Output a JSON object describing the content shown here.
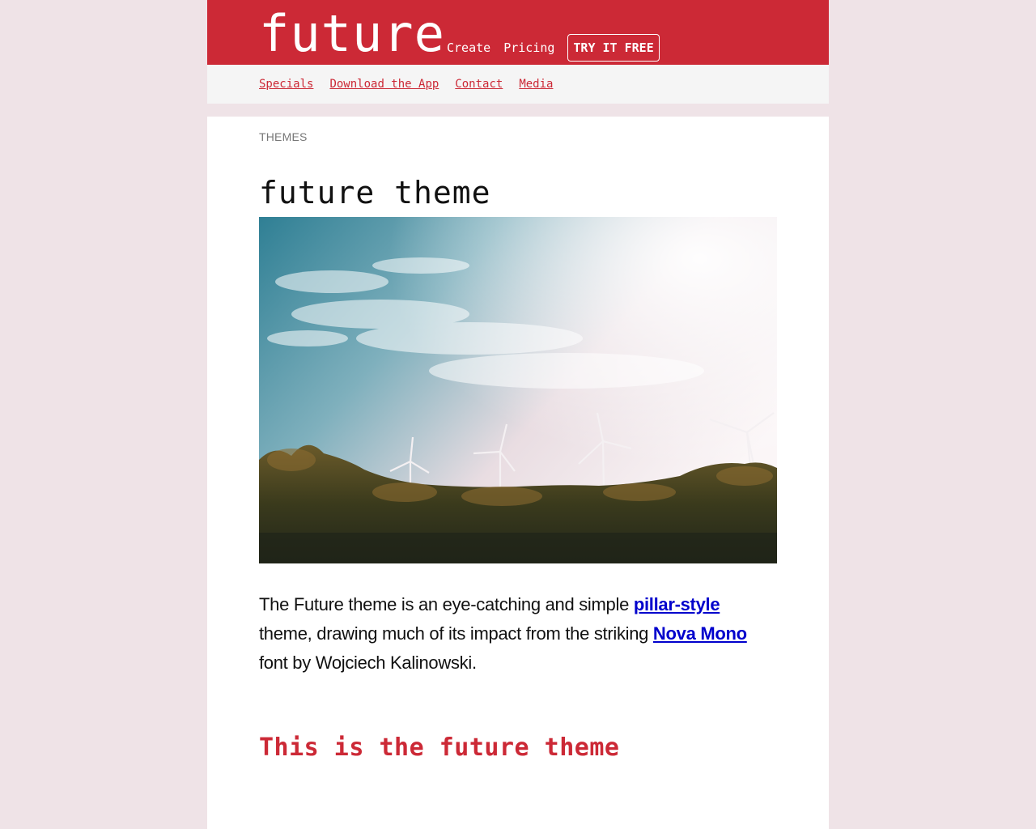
{
  "header": {
    "logo": "future",
    "nav": {
      "create": "Create",
      "pricing": "Pricing",
      "cta": "TRY IT FREE"
    }
  },
  "subnav": {
    "items": [
      "Specials",
      "Download the App",
      "Contact",
      "Media"
    ]
  },
  "main": {
    "breadcrumb": "THEMES",
    "title": "future theme",
    "intro": {
      "text_before": "The Future theme is an eye-catching and simple ",
      "link1": "pillar-style",
      "text_middle": " theme, drawing much of its impact from the striking ",
      "link2": "Nova Mono",
      "text_after": " font by Wojciech Kalinowski."
    },
    "heading1": "This is the future theme"
  },
  "colors": {
    "brand": "#cc2936",
    "background": "#efe3e7",
    "link": "#0000cc"
  }
}
